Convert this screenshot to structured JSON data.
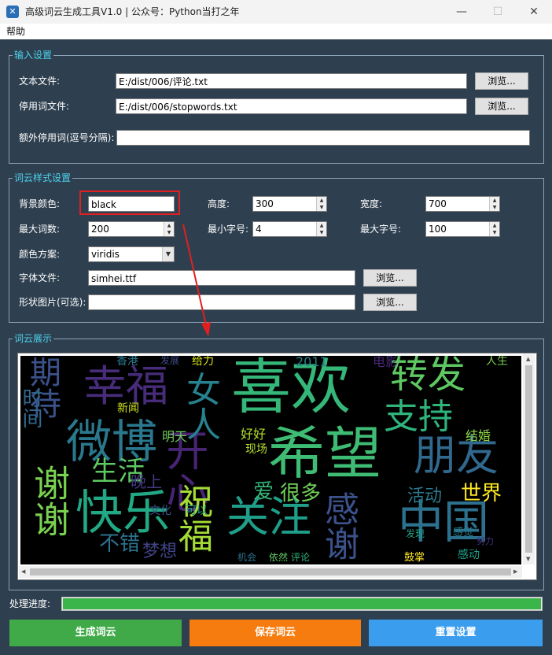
{
  "window": {
    "title": "高级词云生成工具V1.0 | 公众号：Python当打之年",
    "minimize": "—",
    "maximize": "☐",
    "close": "✕"
  },
  "menu": {
    "help": "帮助"
  },
  "input_settings": {
    "title": "输入设置",
    "text_file_label": "文本文件:",
    "text_file_value": "E:/dist/006/评论.txt",
    "stopword_label": "停用词文件:",
    "stopword_value": "E:/dist/006/stopwords.txt",
    "extra_label": "额外停用词(逗号分隔):",
    "extra_value": "",
    "browse": "浏览..."
  },
  "style_settings": {
    "title": "词云样式设置",
    "bg_label": "背景颜色:",
    "bg_value": "black",
    "height_label": "高度:",
    "height_value": "300",
    "width_label": "宽度:",
    "width_value": "700",
    "maxwords_label": "最大词数:",
    "maxwords_value": "200",
    "minfont_label": "最小字号:",
    "minfont_value": "4",
    "maxfont_label": "最大字号:",
    "maxfont_value": "100",
    "colormap_label": "颜色方案:",
    "colormap_value": "viridis",
    "font_label": "字体文件:",
    "font_value": "simhei.ttf",
    "mask_label": "形状图片(可选):",
    "mask_value": "",
    "browse": "浏览..."
  },
  "display": {
    "title": "词云展示"
  },
  "wordcloud_words": [
    {
      "text": "喜欢",
      "color": "#35b779"
    },
    {
      "text": "希望",
      "color": "#3fbc73"
    },
    {
      "text": "幸福",
      "color": "#472c7a"
    },
    {
      "text": "微博",
      "color": "#2a788e"
    },
    {
      "text": "转发",
      "color": "#5ec962"
    },
    {
      "text": "支持",
      "color": "#2fb47c"
    },
    {
      "text": "朋友",
      "color": "#31688e"
    },
    {
      "text": "快乐",
      "color": "#22a884"
    },
    {
      "text": "开心",
      "color": "#482475"
    },
    {
      "text": "关注",
      "color": "#1f9e89"
    },
    {
      "text": "中国",
      "color": "#2c728e"
    },
    {
      "text": "谢谢",
      "color": "#7ad151"
    },
    {
      "text": "期待",
      "color": "#3b528b"
    },
    {
      "text": "祝福",
      "color": "#a5db36"
    },
    {
      "text": "女人",
      "color": "#26828e"
    },
    {
      "text": "生活",
      "color": "#5ec962"
    },
    {
      "text": "世界",
      "color": "#fde725"
    },
    {
      "text": "活动",
      "color": "#2a788e"
    },
    {
      "text": "感谢",
      "color": "#3b528b"
    },
    {
      "text": "时间",
      "color": "#31688e"
    },
    {
      "text": "不错",
      "color": "#2c728e"
    },
    {
      "text": "梦想",
      "color": "#414487"
    },
    {
      "text": "爱",
      "color": "#35b779"
    },
    {
      "text": "很多",
      "color": "#70cf57"
    },
    {
      "text": "晚上",
      "color": "#443983"
    },
    {
      "text": "好好",
      "color": "#b5de2b"
    },
    {
      "text": "明天",
      "color": "#6ece58"
    },
    {
      "text": "新闻",
      "color": "#cfe11c"
    },
    {
      "text": "结婚",
      "color": "#90d743"
    },
    {
      "text": "给力",
      "color": "#d8e219"
    },
    {
      "text": "鼓掌",
      "color": "#fde725"
    },
    {
      "text": "感动",
      "color": "#1fa187"
    },
    {
      "text": "2011",
      "color": "#26828e"
    },
    {
      "text": "电影",
      "color": "#482878"
    },
    {
      "text": "香港",
      "color": "#2a788e"
    },
    {
      "text": "发展",
      "color": "#3e4a89"
    },
    {
      "text": "人生",
      "color": "#7ad151"
    },
    {
      "text": "现场",
      "color": "#b5de2b"
    },
    {
      "text": "可以",
      "color": "#1f9e89"
    },
    {
      "text": "感觉",
      "color": "#287d8e"
    },
    {
      "text": "评论",
      "color": "#31b57b"
    },
    {
      "text": "依然",
      "color": "#5ec962"
    },
    {
      "text": "机会",
      "color": "#2c728e"
    },
    {
      "text": "文化",
      "color": "#3b528b"
    },
    {
      "text": "发现",
      "color": "#20a386"
    },
    {
      "text": "努力",
      "color": "#46337e"
    }
  ],
  "progress": {
    "label": "处理进度:",
    "value": 1.0
  },
  "buttons": {
    "generate": "生成词云",
    "save": "保存词云",
    "reset": "重置设置"
  },
  "colors": {
    "generate": "#3faa47",
    "save": "#f67c0f",
    "reset": "#3b9ded",
    "legend": "#4ed3ee",
    "background": "#2e3f4f",
    "highlight": "#e02020"
  }
}
